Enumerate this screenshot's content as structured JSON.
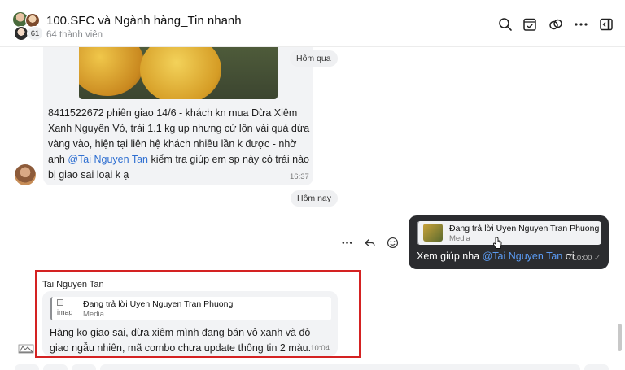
{
  "header": {
    "title": "100.SFC và Ngành hàng_Tin nhanh",
    "members": "64 thành viên",
    "avatar_count": "61",
    "icons": [
      "search-icon",
      "calendar-check-icon",
      "link-icon",
      "more-icon",
      "sidebar-toggle-icon"
    ]
  },
  "messages": {
    "first": {
      "text_part1": "8411522672 phiên giao 14/6 - khách kn mua Dừa Xiêm Xanh Nguyên Vỏ, trái 1.1 kg up nhưng cứ lộn vài quả dừa vàng vào, hiện tại liên hệ khách nhiều lần k được - nhờ anh ",
      "mention": "@Tai Nguyen Tan",
      "text_part2": " kiểm tra giúp em sp này có trái nào bị giao sai loại k ạ",
      "time": "16:37"
    },
    "date_yesterday": "Hôm qua",
    "date_today": "Hôm nay",
    "outgoing": {
      "quote_title": "Đang trả lời Uyen Nguyen Tran Phuong",
      "quote_sub": "Media",
      "text_prefix": "Xem giúp nha ",
      "mention": "@Tai Nguyen Tan",
      "text_suffix": " ơi",
      "time": "10:00"
    },
    "reply": {
      "sender": "Tai Nguyen Tan",
      "quote_title": "Đang trả lời Uyen Nguyen Tran Phuong",
      "quote_sub": "Media",
      "broken_image_alt": "imag",
      "text": "Hàng ko giao sai, dừa xiêm mình đang bán vỏ xanh và đỏ giao ngẫu nhiên, mã combo chưa update thông tin 2 màu.",
      "time": "10:04"
    }
  },
  "actions": [
    "more-icon",
    "reply-icon",
    "emoji-icon"
  ],
  "colors": {
    "highlight": "#d42222",
    "mention": "#2f6fd1",
    "outgoing_bg": "#2b2c2f"
  }
}
